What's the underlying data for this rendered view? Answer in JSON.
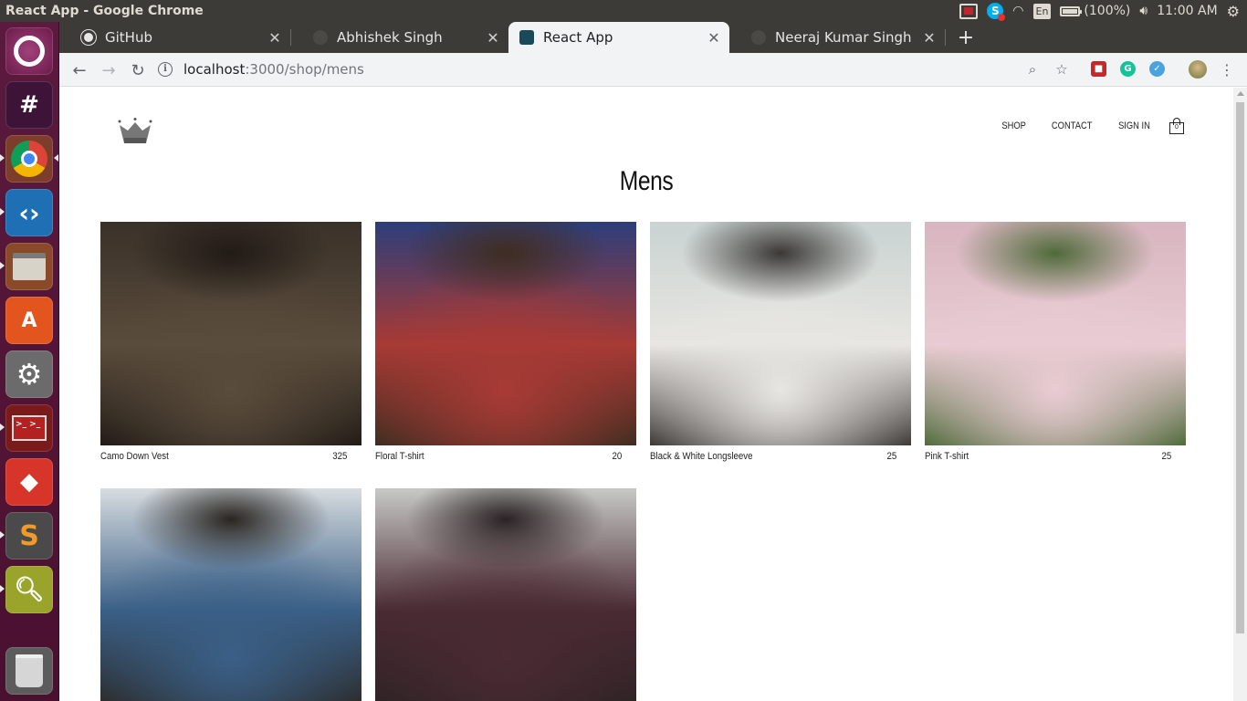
{
  "os": {
    "window_title": "React App - Google Chrome",
    "language": "En",
    "battery": "(100%)",
    "time": "11:00 AM"
  },
  "browser": {
    "tabs": [
      {
        "label": "GitHub",
        "active": false
      },
      {
        "label": "Abhishek Singh",
        "active": false
      },
      {
        "label": "React App",
        "active": true
      },
      {
        "label": "Neeraj Kumar Singh",
        "active": false
      }
    ],
    "url_host": "localhost",
    "url_rest": ":3000/shop/mens"
  },
  "site": {
    "nav": {
      "shop": "SHOP",
      "contact": "CONTACT",
      "sign_in": "SIGN IN",
      "cart_count": "0"
    },
    "page_title": "Mens",
    "products": [
      {
        "name": "Camo Down Vest",
        "price": "325",
        "colors": [
          "#3a3129",
          "#5a4c3c",
          "#211b16"
        ]
      },
      {
        "name": "Floral T-shirt",
        "price": "20",
        "colors": [
          "#2c3e7a",
          "#a83a35",
          "#3e2d20"
        ]
      },
      {
        "name": "Black & White Longsleeve",
        "price": "25",
        "colors": [
          "#c9d3d2",
          "#e8e6e2",
          "#3b3835"
        ]
      },
      {
        "name": "Pink T-shirt",
        "price": "25",
        "colors": [
          "#d8b5c0",
          "#e9ccd3",
          "#4f6a3a"
        ]
      },
      {
        "name": "",
        "price": "",
        "colors": [
          "#d7dce0",
          "#3a5f86",
          "#2a2520"
        ]
      },
      {
        "name": "",
        "price": "",
        "colors": [
          "#c7c9c7",
          "#4a2a33",
          "#2a2224"
        ]
      }
    ]
  }
}
